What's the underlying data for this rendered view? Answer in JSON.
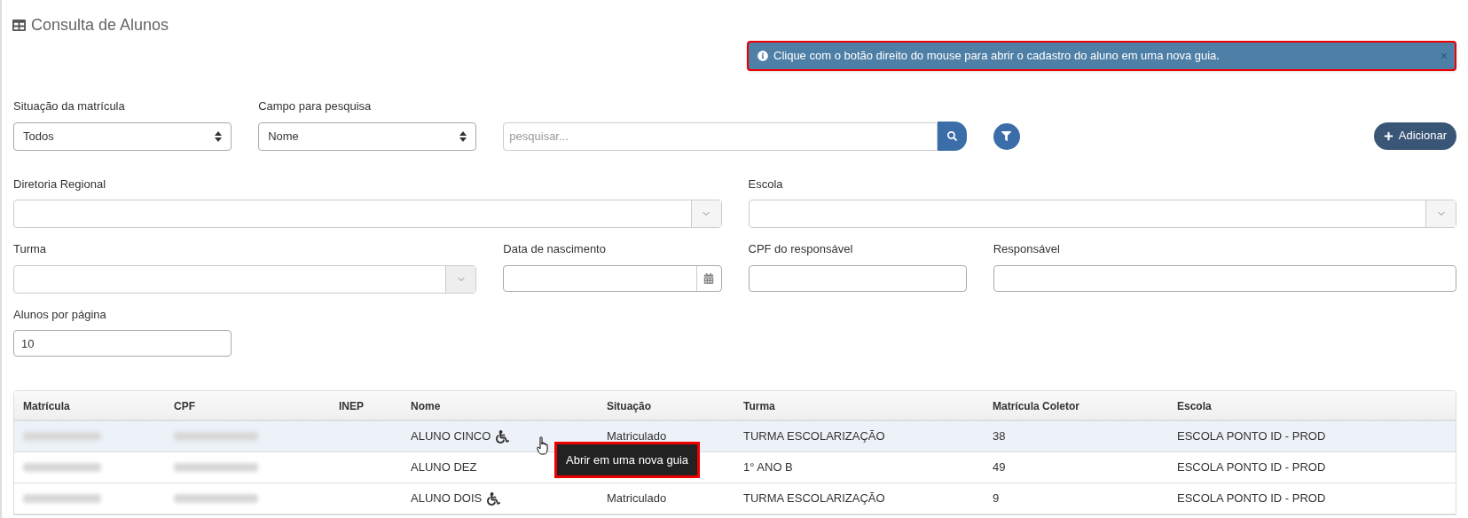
{
  "title": "Consulta de Alunos",
  "alert": {
    "text": "Clique com o botão direito do mouse para abrir o cadastro do aluno em uma nova guia.",
    "close": "×"
  },
  "filters": {
    "situacao": {
      "label": "Situação da matrícula",
      "value": "Todos"
    },
    "campo": {
      "label": "Campo para pesquisa",
      "value": "Nome"
    },
    "search": {
      "placeholder": "pesquisar..."
    },
    "add_button": "Adicionar"
  },
  "fields": [
    {
      "label": "Diretoria Regional",
      "kind": "combo"
    },
    {
      "label": "Escola",
      "kind": "combo"
    },
    {
      "label": "Turma",
      "kind": "combo-disabled"
    },
    {
      "label": "Data de nascimento",
      "kind": "date"
    },
    {
      "label": "CPF do responsável",
      "kind": "text"
    },
    {
      "label": "Responsável",
      "kind": "text"
    },
    {
      "label": "Alunos por página",
      "kind": "text",
      "value": "10"
    }
  ],
  "table": {
    "columns": [
      "Matrícula",
      "CPF",
      "INEP",
      "Nome",
      "Situação",
      "Turma",
      "Matrícula Coletor",
      "Escola"
    ],
    "rows": [
      {
        "nome": "ALUNO CINCO",
        "accessible": true,
        "situacao": "Matriculado",
        "turma": "TURMA ESCOLARIZAÇÃO",
        "coletor": "38",
        "escola": "ESCOLA PONTO ID - PROD",
        "selected": true
      },
      {
        "nome": "ALUNO DEZ",
        "accessible": false,
        "turma": "1° ANO B",
        "coletor": "49",
        "escola": "ESCOLA PONTO ID - PROD",
        "selected": false
      },
      {
        "nome": "ALUNO DOIS",
        "accessible": true,
        "situacao": "Matriculado",
        "turma": "TURMA ESCOLARIZAÇÃO",
        "coletor": "9",
        "escola": "ESCOLA PONTO ID - PROD",
        "selected": false
      }
    ]
  },
  "tooltip": "Abrir em uma nova guia"
}
